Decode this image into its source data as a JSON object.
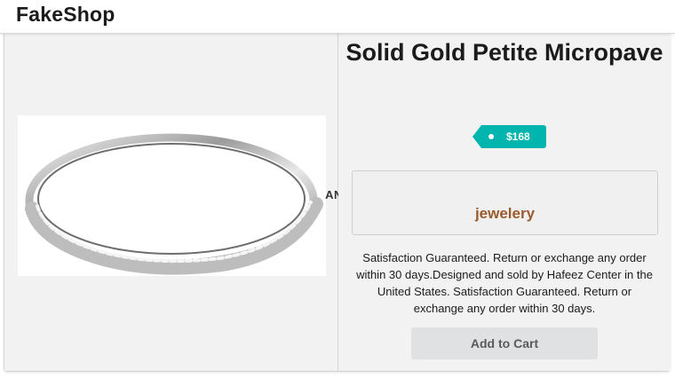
{
  "header": {
    "brand": "FakeShop"
  },
  "product": {
    "title": "Solid Gold Petite Micropave",
    "price": "$168",
    "divider": "AND",
    "category": "jewelery",
    "description": "Satisfaction Guaranteed. Return or exchange any order within 30 days.Designed and sold by Hafeez Center in the United States. Satisfaction Guaranteed. Return or exchange any order within 30 days.",
    "add_to_cart_label": "Add to Cart",
    "image_alt": "product image of a silver micropave ring"
  },
  "colors": {
    "price_tag": "#00b5ad",
    "category_text": "#9a5a2c",
    "button_bg": "#e0e1e2",
    "panel_bg": "#f2f2f3"
  },
  "icons": {
    "price_tag": "tag-icon"
  }
}
